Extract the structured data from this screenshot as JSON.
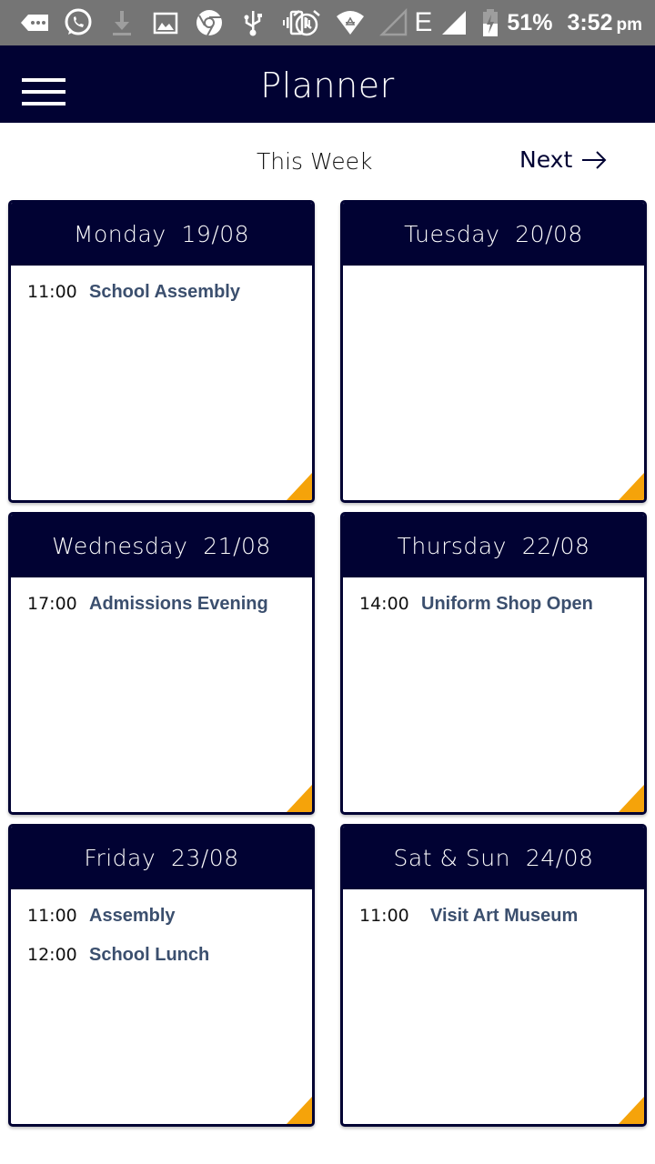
{
  "status_bar": {
    "icons": [
      "message-icon",
      "whatsapp-icon",
      "download-icon",
      "image-icon",
      "chrome-icon",
      "usb-icon",
      "vibrate-icon",
      "alarm-icon",
      "wifi-icon",
      "signal-empty-icon",
      "network-type-icon",
      "signal-icon",
      "battery-charging-icon"
    ],
    "network_type": "E",
    "battery": "51%",
    "time": "3:52",
    "ampm": "pm"
  },
  "app_bar": {
    "title": "Planner",
    "menu_icon": "hamburger-menu-icon"
  },
  "week_nav": {
    "current_label": "This Week",
    "next_label": "Next",
    "next_icon": "arrow-right-icon"
  },
  "colors": {
    "primary": "#010233",
    "accent": "#f5a30a",
    "event_title": "#3b4f6e",
    "status_bar": "#757575"
  },
  "days": [
    {
      "label": "Monday  19/08",
      "events": [
        {
          "time": "11:00",
          "title": "School Assembly"
        }
      ]
    },
    {
      "label": "Tuesday  20/08",
      "events": []
    },
    {
      "label": "Wednesday  21/08",
      "events": [
        {
          "time": "17:00",
          "title": "Admissions Evening"
        }
      ]
    },
    {
      "label": "Thursday  22/08",
      "events": [
        {
          "time": "14:00",
          "title": "Uniform Shop Open"
        }
      ]
    },
    {
      "label": "Friday  23/08",
      "events": [
        {
          "time": "11:00",
          "title": "Assembly"
        },
        {
          "time": "12:00",
          "title": "School Lunch"
        }
      ]
    },
    {
      "label": "Sat & Sun  24/08",
      "events": [
        {
          "time": "11:00",
          "title": "Visit Art Museum"
        }
      ]
    }
  ]
}
